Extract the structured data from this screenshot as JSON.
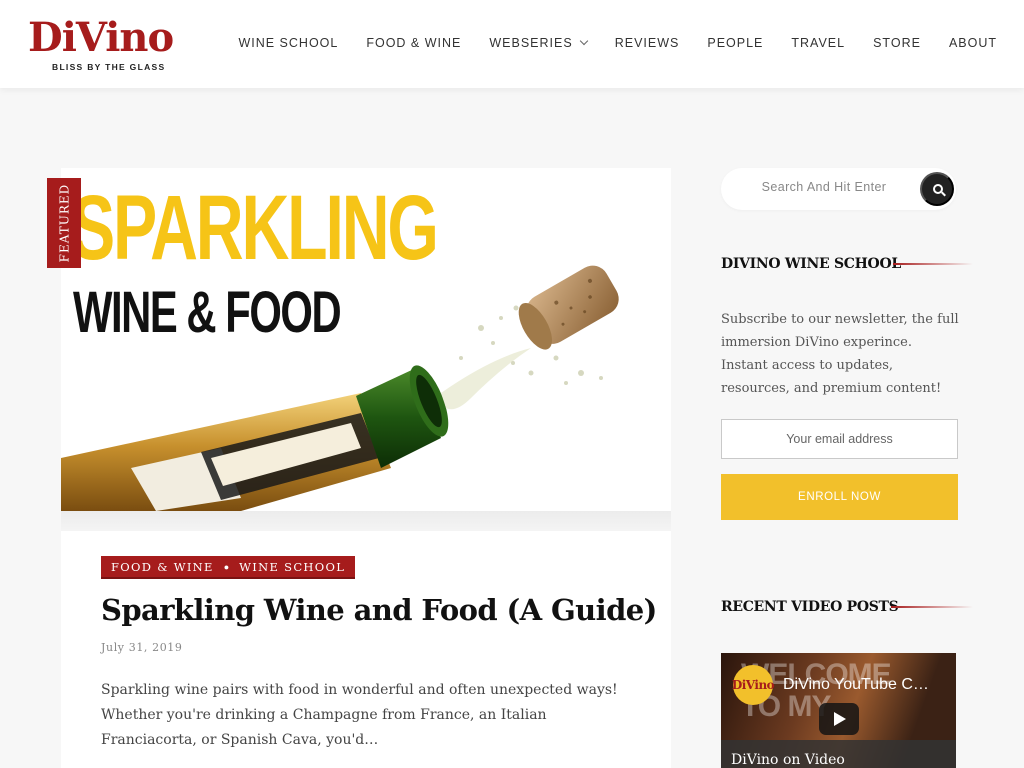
{
  "header": {
    "logo": "DiVino",
    "tagline": "BLISS BY THE GLASS",
    "nav": [
      {
        "label": "WINE SCHOOL"
      },
      {
        "label": "FOOD & WINE"
      },
      {
        "label": "WEBSERIES"
      },
      {
        "label": "REVIEWS"
      },
      {
        "label": "PEOPLE"
      },
      {
        "label": "TRAVEL"
      },
      {
        "label": "STORE"
      },
      {
        "label": "ABOUT"
      }
    ]
  },
  "featured": {
    "ribbon": "FEATURED",
    "image_title_line1": "SPARKLING",
    "image_title_line2": "WINE & FOOD",
    "categories": [
      "FOOD & WINE",
      "WINE SCHOOL"
    ],
    "title": "Sparkling Wine and Food (A Guide)",
    "date": "July 31, 2019",
    "excerpt": "Sparkling wine pairs with food in wonderful and often unexpected ways! Whether you're drinking a Champagne from France, an Italian Franciacorta, or Spanish Cava, you'd…"
  },
  "sidebar": {
    "search_placeholder": "Search And Hit Enter",
    "school_title": "DIVINO WINE SCHOOL",
    "newsletter_text": "Subscribe to our newsletter, the full immersion DiVino experince. Instant access to updates, resources, and premium content!",
    "email_placeholder": "Your email address",
    "enroll_label": "ENROLL NOW",
    "videos_title": "RECENT VIDEO POSTS",
    "video": {
      "channel_logo": "DiVino",
      "title": "DiVino YouTube C…",
      "bg_text_1": "WELCOME",
      "bg_text_2": "TO MY",
      "caption": "DiVino on Video"
    }
  },
  "colors": {
    "brand_red": "#a61c1c",
    "accent_yellow": "#f2c02b",
    "page_bg": "#f7f7f7"
  }
}
